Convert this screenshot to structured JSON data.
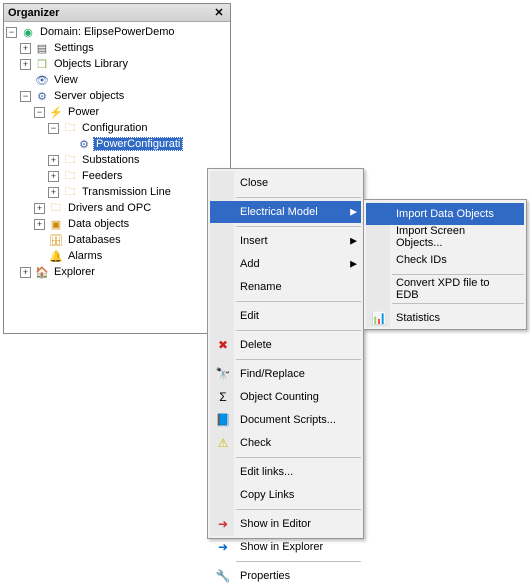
{
  "panel": {
    "title": "Organizer"
  },
  "tree": {
    "n0": {
      "label": "Domain: ElipsePowerDemo"
    },
    "n1": {
      "label": "Settings"
    },
    "n2": {
      "label": "Objects Library"
    },
    "n3": {
      "label": "View"
    },
    "n4": {
      "label": "Server objects"
    },
    "n5": {
      "label": "Power"
    },
    "n6": {
      "label": "Configuration"
    },
    "n7": {
      "label": "PowerConfigurati"
    },
    "n8": {
      "label": "Substations"
    },
    "n9": {
      "label": "Feeders"
    },
    "n10": {
      "label": "Transmission Line"
    },
    "n11": {
      "label": "Drivers and OPC"
    },
    "n12": {
      "label": "Data objects"
    },
    "n13": {
      "label": "Databases"
    },
    "n14": {
      "label": "Alarms"
    },
    "n15": {
      "label": "Explorer"
    }
  },
  "menu1": {
    "close": "Close",
    "electrical": "Electrical Model",
    "insert": "Insert",
    "add": "Add",
    "rename": "Rename",
    "edit": "Edit",
    "delete": "Delete",
    "find": "Find/Replace",
    "count": "Object Counting",
    "scripts": "Document Scripts...",
    "check": "Check",
    "editlinks": "Edit links...",
    "copylinks": "Copy Links",
    "showeditor": "Show in Editor",
    "showexpl": "Show in Explorer",
    "properties": "Properties"
  },
  "menu2": {
    "importdata": "Import Data Objects",
    "importscreen": "Import Screen Objects...",
    "checkids": "Check IDs",
    "convert": "Convert XPD file to EDB",
    "stats": "Statistics"
  }
}
